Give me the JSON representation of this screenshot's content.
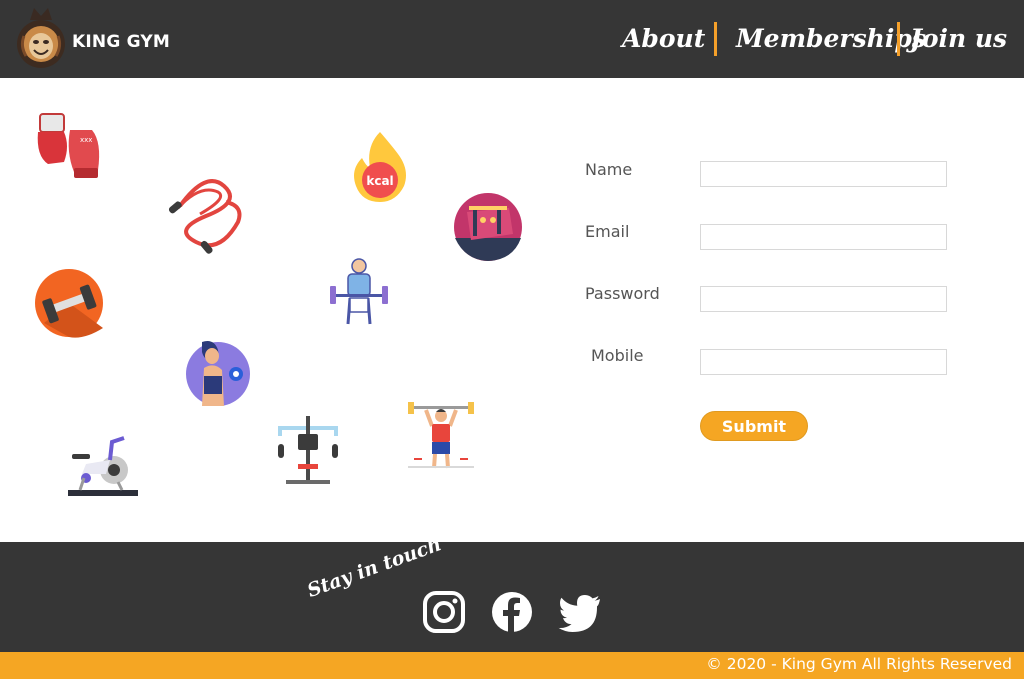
{
  "header": {
    "brand": "KING GYM",
    "logo_icon": "lion-head-icon",
    "nav": [
      {
        "label": "About"
      },
      {
        "label": "Memberships"
      },
      {
        "label": "Join us"
      }
    ]
  },
  "illustrations": [
    "boxing-gloves-icon",
    "calorie-fire-icon",
    "jump-rope-icon",
    "gym-equipment-circle-icon",
    "dumbbell-circle-icon",
    "weightlifter-icon",
    "woman-dumbbell-icon",
    "exercise-bike-icon",
    "weight-machine-icon",
    "man-lifting-barbell-icon"
  ],
  "calorie_badge": "kcal",
  "form": {
    "fields": [
      {
        "label": "Name",
        "value": "",
        "placeholder": ""
      },
      {
        "label": "Email",
        "value": "",
        "placeholder": ""
      },
      {
        "label": "Password",
        "value": "",
        "placeholder": ""
      },
      {
        "label": "Mobile",
        "value": "",
        "placeholder": ""
      }
    ],
    "submit_label": "Submit"
  },
  "footer": {
    "tagline": "Stay in touch",
    "social": [
      "instagram-icon",
      "facebook-icon",
      "twitter-icon"
    ],
    "copyright": "© 2020 - King Gym All Rights Reserved"
  },
  "colors": {
    "header_bg": "#363636",
    "accent": "#f5a623",
    "text": "#ffffff"
  }
}
